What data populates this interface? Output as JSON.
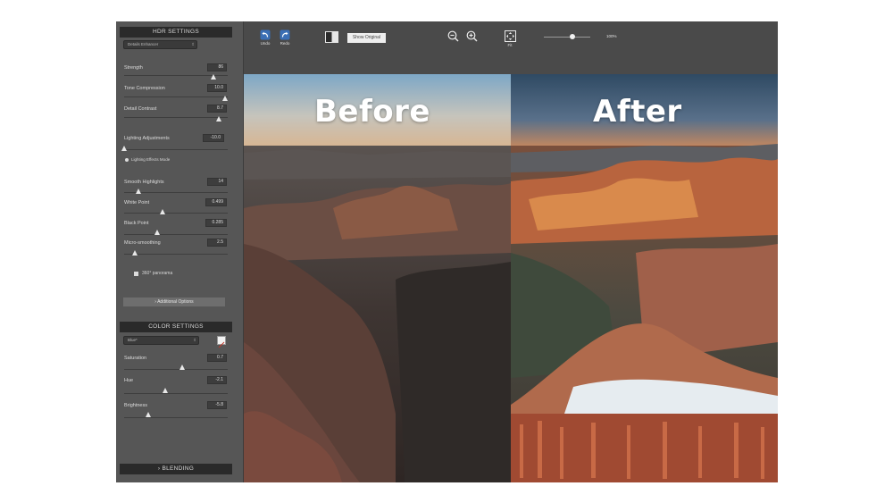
{
  "hdr_settings": {
    "title": "HDR SETTINGS",
    "preset": "Details Enhancer",
    "sliders": [
      {
        "label": "Strength",
        "value": "86",
        "level": 0.86
      },
      {
        "label": "Tone Compression",
        "value": "10.0",
        "level": 0.97
      },
      {
        "label": "Detail Contrast",
        "value": "8.7",
        "level": 0.91
      },
      {
        "label": "Lighting Adjustments",
        "value": "-10.0",
        "level": 0.0
      },
      {
        "label": "Smooth Highlights",
        "value": "14",
        "level": 0.14
      },
      {
        "label": "White Point",
        "value": "0.499",
        "level": 0.37
      },
      {
        "label": "Black Point",
        "value": "0.285",
        "level": 0.32
      },
      {
        "label": "Micro-smoothing",
        "value": "2.5",
        "level": 0.1
      }
    ],
    "lighting_mode_label": "Lighting Effects Mode",
    "panorama_label": "360° panorama",
    "additional_options_label": "Additional Options"
  },
  "color_settings": {
    "title": "COLOR SETTINGS",
    "preset": "Blue*",
    "sliders": [
      {
        "label": "Saturation",
        "value": "0.7",
        "level": 0.56
      },
      {
        "label": "Hue",
        "value": "-2.1",
        "level": 0.4
      },
      {
        "label": "Brightness",
        "value": "-5.8",
        "level": 0.23
      }
    ]
  },
  "blending": {
    "title": "BLENDING"
  },
  "toolbar": {
    "undo_label": "Undo",
    "redo_label": "Redo",
    "show_original_label": "Show Original",
    "fit_label": "Fit",
    "zoom_value": "100%",
    "zoom_level": 0.62
  },
  "preview": {
    "before_label": "Before",
    "after_label": "After"
  },
  "colors": {
    "panel_bg": "#565656",
    "toolbar_bg": "#4a4a4a",
    "header_bg": "#2a2a2a",
    "undo_icon": "#6aa0e0"
  },
  "icons": [
    "undo-icon",
    "redo-icon",
    "compare-icon",
    "zoom-out-icon",
    "zoom-in-icon",
    "fit-icon",
    "color-picker-icon",
    "chevron-right-icon"
  ]
}
